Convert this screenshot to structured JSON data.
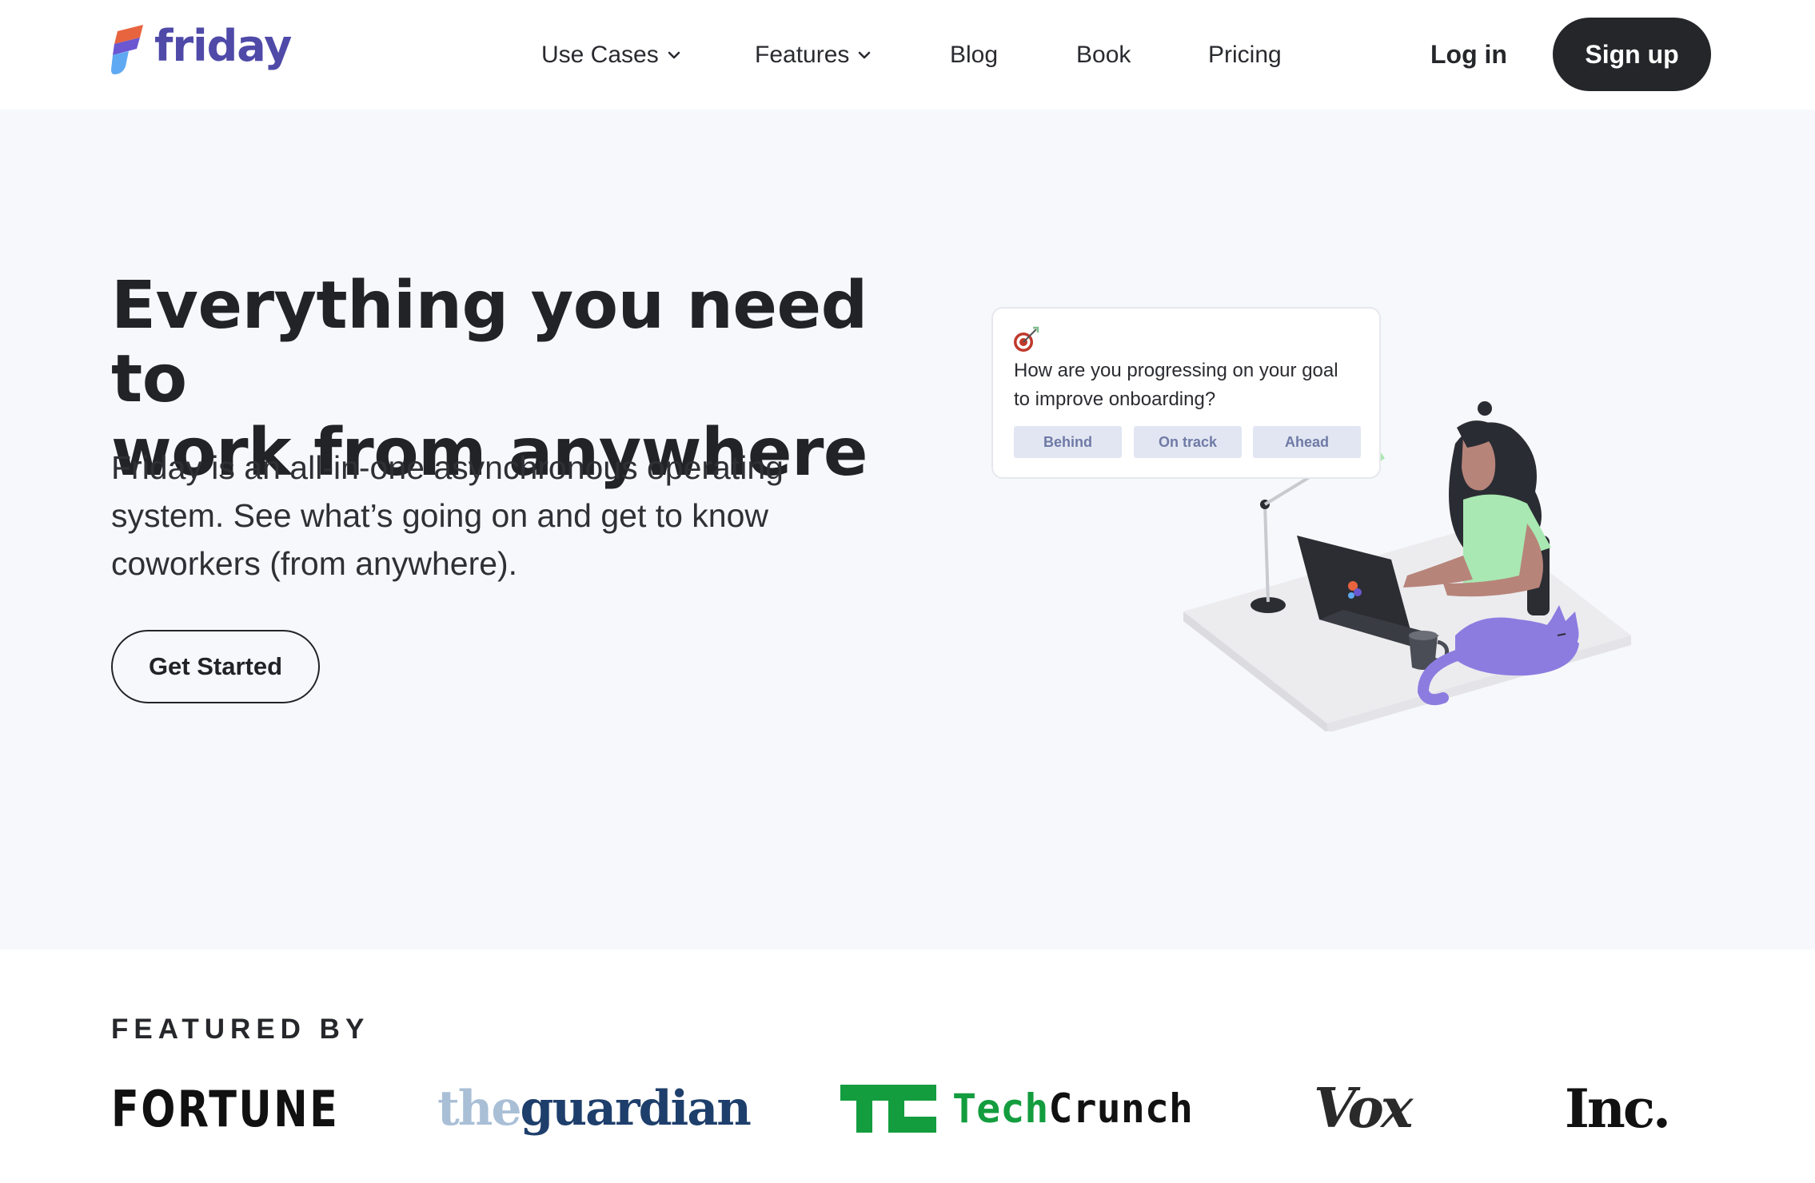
{
  "brand": {
    "name": "friday"
  },
  "nav": {
    "links": [
      {
        "label": "Use Cases",
        "has_dropdown": true
      },
      {
        "label": "Features",
        "has_dropdown": true
      },
      {
        "label": "Blog",
        "has_dropdown": false
      },
      {
        "label": "Book",
        "has_dropdown": false
      },
      {
        "label": "Pricing",
        "has_dropdown": false
      }
    ],
    "login_label": "Log in",
    "signup_label": "Sign up"
  },
  "hero": {
    "title_line1": "Everything you need to",
    "title_line2": "work from anywhere",
    "desc_line1": "Friday is an all-in-one asynchronous operating",
    "desc_line2": "system. See what’s going on and get to know",
    "desc_line3": "coworkers (from anywhere).",
    "cta_label": "Get Started"
  },
  "goal_card": {
    "icon": "target-icon",
    "question_line1": "How are you progressing on your goal",
    "question_line2": "to improve onboarding?",
    "options": [
      "Behind",
      "On track",
      "Ahead"
    ]
  },
  "featured": {
    "heading": "FEATURED BY",
    "logos": {
      "fortune": "FORTUNE",
      "guardian_the": "the",
      "guardian_name": "guardian",
      "techcrunch_tech": "Tech",
      "techcrunch_crunch": "Crunch",
      "vox": "Vox",
      "inc": "Inc."
    }
  },
  "colors": {
    "brand": "#4f4aa8",
    "dark": "#25262a",
    "hero_bg": "#f7f8fb",
    "option_bg": "#e1e6f2",
    "option_text": "#6f7aa6",
    "techcrunch_green": "#139d3f",
    "guardian_blue": "#1e3f6b"
  }
}
